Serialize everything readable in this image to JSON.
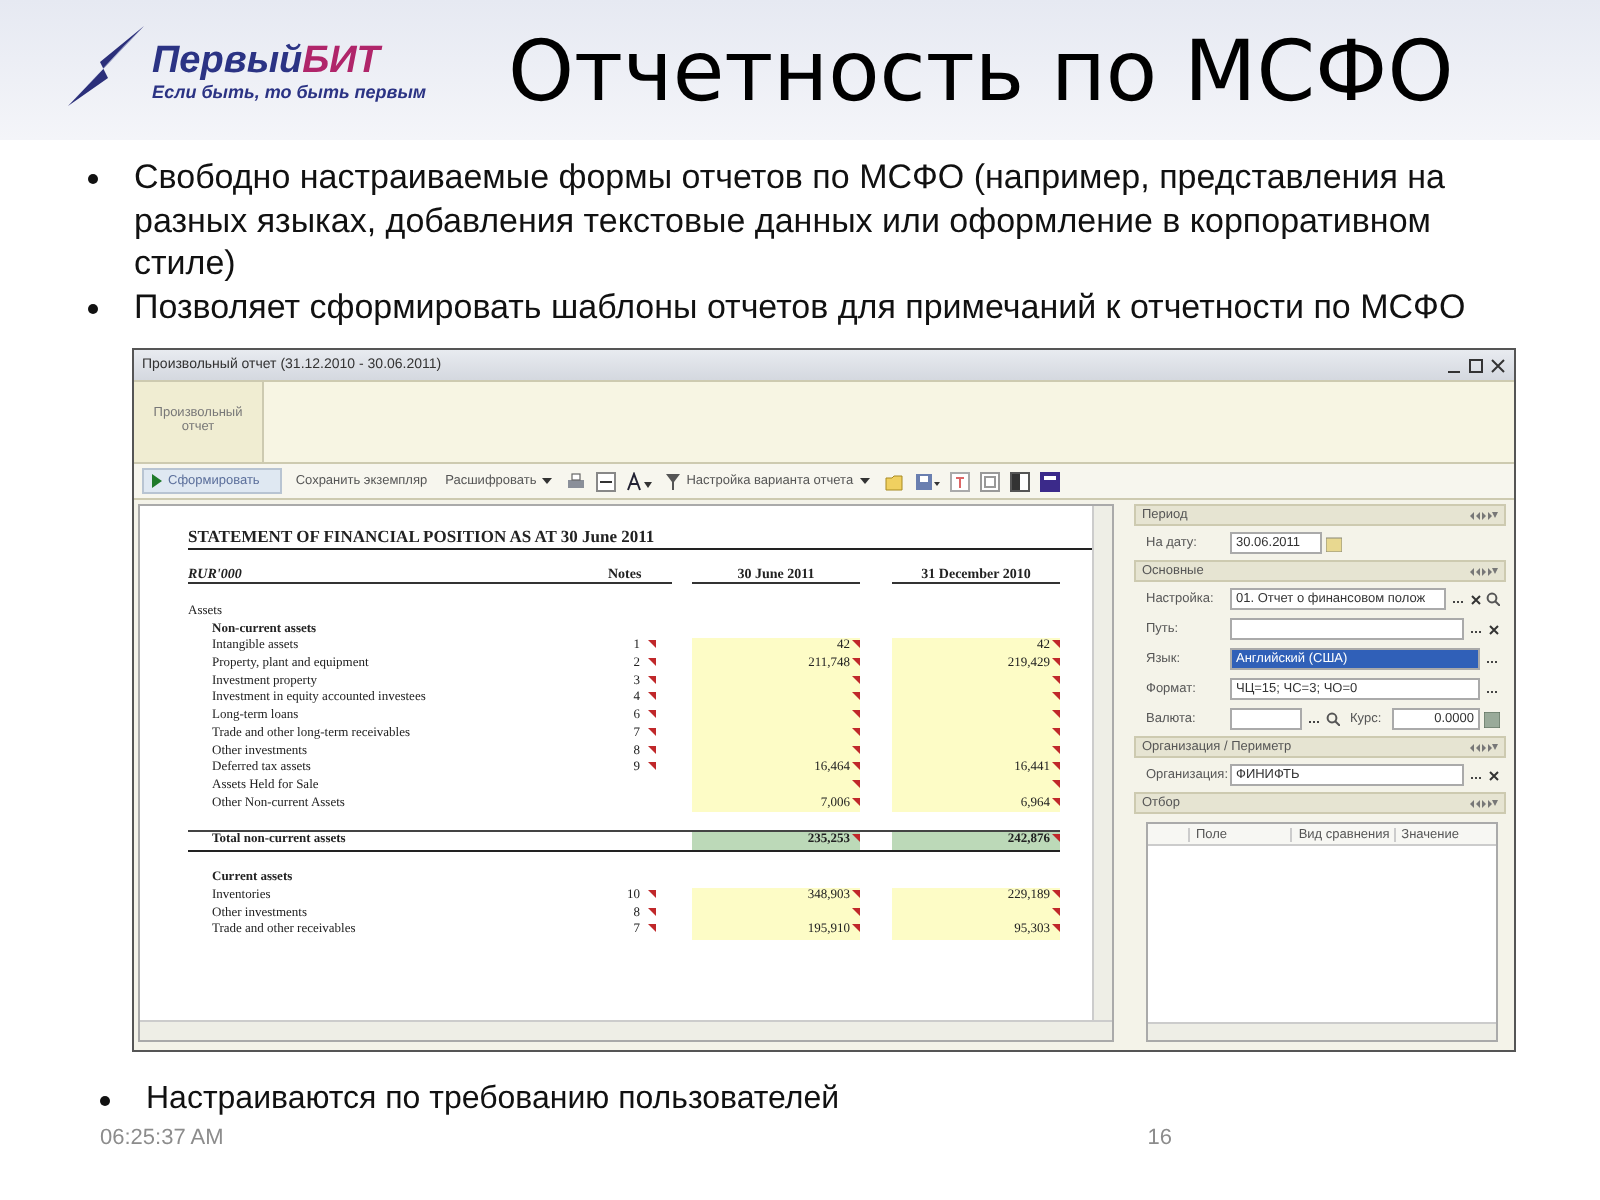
{
  "header": {
    "logo": {
      "name_main": "Первый",
      "name_accent": "БИТ",
      "tagline": "Если быть, то быть первым"
    },
    "title": "Отчетность по МСФО"
  },
  "bullets": [
    "Свободно настраиваемые формы отчетов по МСФО (например, представления на разных языках, добавления текстовые данных или оформление в корпоративном стиле)",
    "Позволяет сформировать шаблоны отчетов для примечаний к отчетности по МСФО"
  ],
  "window": {
    "title": "Произвольный отчет (31.12.2010 - 30.06.2011)",
    "tab": "Произвольный отчет",
    "toolbar": {
      "generate": "Сформировать",
      "save_copy": "Сохранить экземпляр",
      "decode": "Расшифровать",
      "variant_settings": "Настройка варианта отчета"
    },
    "report": {
      "title": "STATEMENT OF FINANCIAL POSITION AS AT 30 June 2011",
      "currency": "RUR'000",
      "columns": [
        "Notes",
        "30 June 2011",
        "31 December 2010"
      ],
      "rows": [
        {
          "kind": "section",
          "label": "Assets"
        },
        {
          "kind": "group",
          "label": "Non-current assets"
        },
        {
          "kind": "item",
          "label": "Intangible assets",
          "note": "1",
          "flagged": true,
          "v1": "42",
          "v2": "42"
        },
        {
          "kind": "item",
          "label": "Property, plant and equipment",
          "note": "2",
          "flagged": true,
          "v1": "211,748",
          "v2": "219,429"
        },
        {
          "kind": "item",
          "label": "Investment property",
          "note": "3",
          "flagged": true
        },
        {
          "kind": "item",
          "label": "Investment in equity accounted investees",
          "note": "4",
          "flagged": true
        },
        {
          "kind": "item",
          "label": "Long-term loans",
          "note": "6",
          "flagged": true
        },
        {
          "kind": "item",
          "label": "Trade and other long-term receivables",
          "note": "7",
          "flagged": true
        },
        {
          "kind": "item",
          "label": "Other investments",
          "note": "8",
          "flagged": true
        },
        {
          "kind": "item",
          "label": "Deferred tax assets",
          "note": "9",
          "flagged": true,
          "v1": "16,464",
          "v2": "16,441"
        },
        {
          "kind": "item",
          "label": "Assets Held for Sale",
          "flagged": false
        },
        {
          "kind": "item",
          "label": "Other Non-current Assets",
          "flagged": false,
          "v1": "7,006",
          "v2": "6,964"
        },
        {
          "kind": "spacer"
        },
        {
          "kind": "total",
          "label": "Total non-current assets",
          "v1": "235,253",
          "v2": "242,876"
        },
        {
          "kind": "spacer"
        },
        {
          "kind": "group",
          "label": "Current assets"
        },
        {
          "kind": "item",
          "label": "Inventories",
          "note": "10",
          "flagged": true,
          "v1": "348,903",
          "v2": "229,189"
        },
        {
          "kind": "item",
          "label": "Other investments",
          "note": "8",
          "flagged": true
        },
        {
          "kind": "item",
          "label": "Trade and other receivables",
          "note": "7",
          "flagged": true,
          "v1": "195,910",
          "v2": "95,303"
        }
      ]
    },
    "settings_panel": {
      "period": {
        "title": "Период",
        "date_label": "На дату:",
        "date": "30.06.2011"
      },
      "main": {
        "title": "Основные",
        "setting_label": "Настройка:",
        "setting": "01. Отчет о финансовом полож",
        "path_label": "Путь:",
        "language_label": "Язык:",
        "language": "Английский (США)",
        "language_selected": true,
        "format_label": "Формат:",
        "format": "ЧЦ=15; ЧС=3; ЧО=0",
        "currency_label": "Валюта:",
        "rate_label": "Курс:",
        "rate": "0.0000"
      },
      "organization": {
        "title": "Организация / Периметр",
        "org_label": "Организация:",
        "org": "ФИНИФТЬ"
      },
      "filter": {
        "title": "Отбор",
        "columns": [
          "Поле",
          "Вид сравнения",
          "Значение"
        ]
      }
    }
  },
  "bottom_bullet": "Настраиваются по требованию пользователей",
  "footer": {
    "time": "06:25:37 AM",
    "page": "16"
  }
}
